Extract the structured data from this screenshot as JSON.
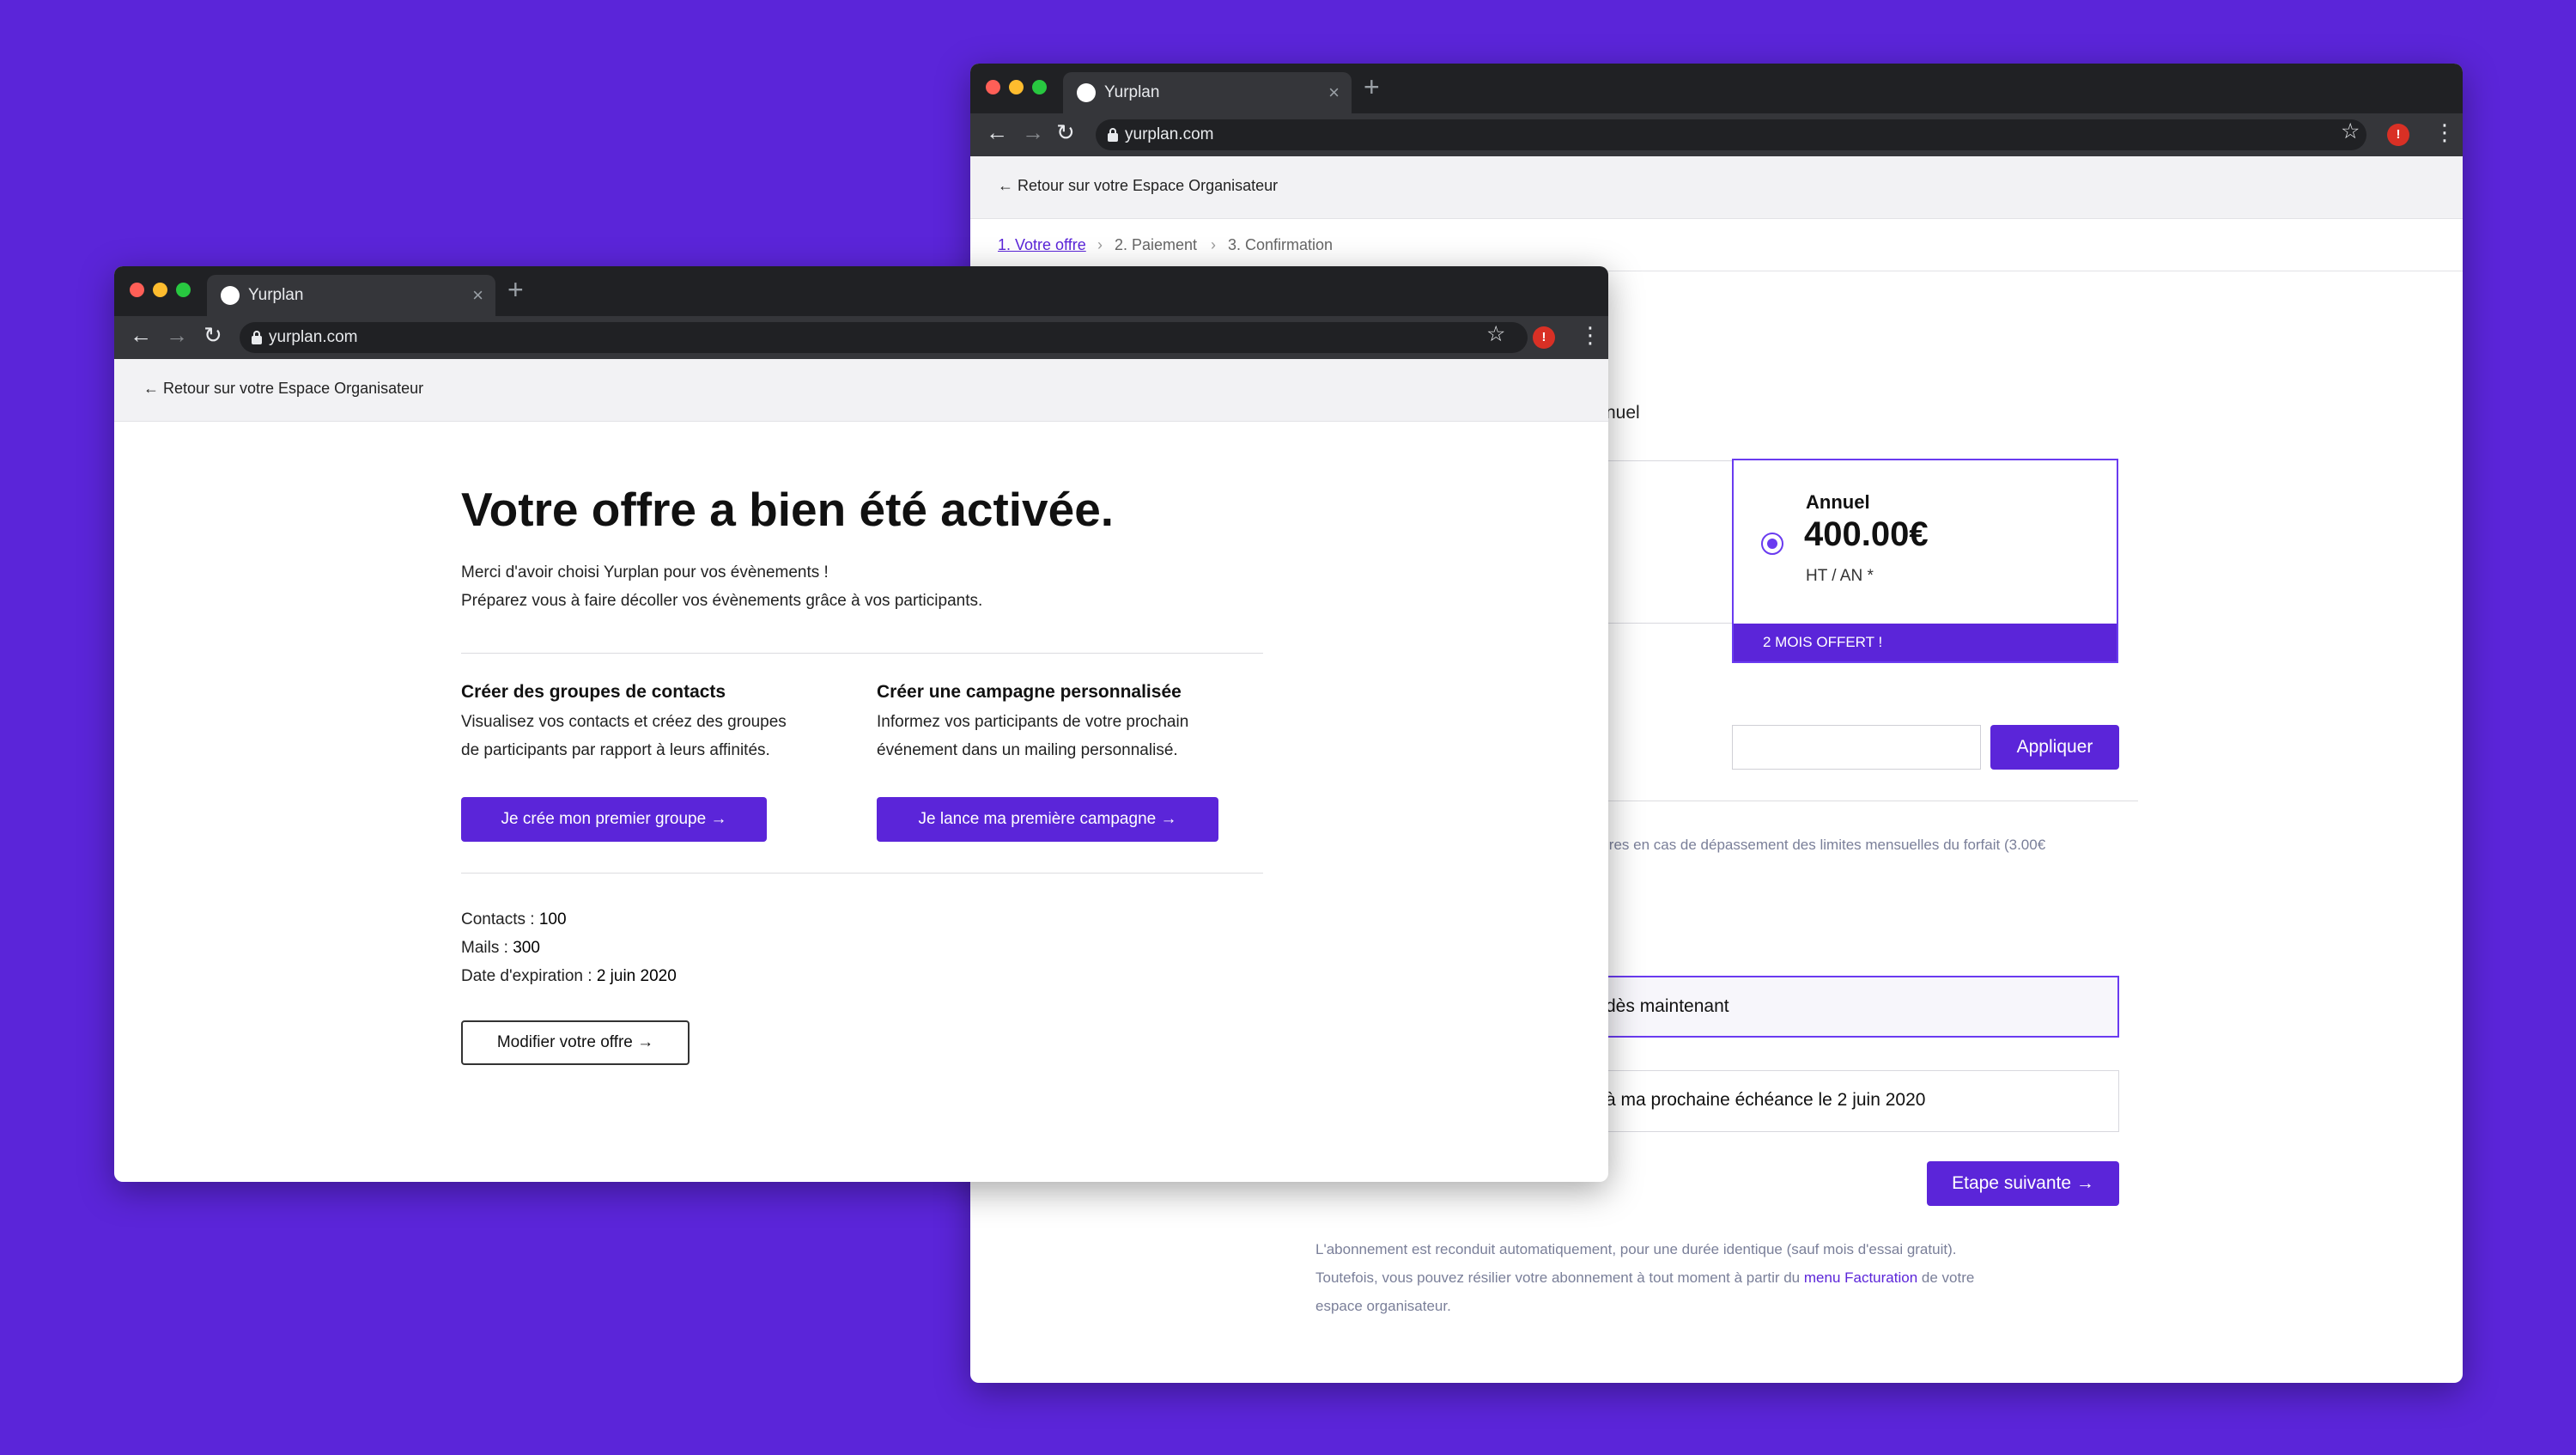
{
  "colors": {
    "background": "#5b25d9",
    "accent": "#5b25d9",
    "accent_light": "#6a3bf0",
    "tab_bar": "#202124",
    "toolbar": "#35363a"
  },
  "browser": {
    "tab_title": "Yurplan",
    "tab_close": "×",
    "new_tab": "+",
    "url": "yurplan.com",
    "icons": {
      "back": "arrow-left-icon",
      "forward": "arrow-right-icon",
      "reload": "reload-icon",
      "lock": "lock-icon",
      "bookmark": "star-icon",
      "extension": "extension-icon",
      "menu": "three-dots-icon"
    },
    "back_glyph": "←",
    "forward_glyph": "→",
    "reload_glyph": "↻",
    "star_glyph": "☆",
    "menu_glyph": "⋮",
    "extension_glyph": "!"
  },
  "back_window": {
    "back_link": "← Retour sur votre Espace Organisateur",
    "breadcrumb": {
      "step1": "1. Votre offre",
      "step2": "2. Paiement",
      "step3": "3. Confirmation",
      "separator": "›"
    },
    "period_label_partial": "nuel",
    "plan": {
      "name": "Annuel",
      "price": "400.00€",
      "unit": "HT / AN *",
      "banner": "2 MOIS OFFERT !",
      "selected": true
    },
    "apply_button": "Appliquer",
    "promo_input_value": "",
    "overage_note_partial": "ires en cas de dépassement des limites mensuelles du forfait (3.00€",
    "option_now": "dès maintenant",
    "option_next": "à ma prochaine échéance le 2 juin 2020",
    "next_button": "Etape suivante →",
    "footnote_line1": "L'abonnement est reconduit automatiquement, pour une durée identique (sauf mois d'essai gratuit).",
    "footnote_line2_pre": "Toutefois, vous pouvez résilier votre abonnement à tout moment à partir du ",
    "footnote_link": "menu Facturation",
    "footnote_line2_post": " de votre",
    "footnote_line3": "espace organisateur."
  },
  "front_window": {
    "back_link": "← Retour sur votre Espace Organisateur",
    "heading": "Votre offre a bien été activée.",
    "intro_line1": "Merci d'avoir choisi Yurplan pour vos évènements !",
    "intro_line2": "Préparez vous à faire décoller vos évènements grâce à vos participants.",
    "groups": {
      "title": "Créer des groupes de contacts",
      "desc_line1": "Visualisez vos contacts et créez des groupes",
      "desc_line2": "de participants par rapport à leurs affinités.",
      "button": "Je crée mon premier groupe →"
    },
    "campaign": {
      "title": "Créer une campagne personnalisée",
      "desc_line1": "Informez vos participants de votre prochain",
      "desc_line2": "événement dans un mailing personnalisé.",
      "button": "Je lance ma première campagne →"
    },
    "stats": {
      "contacts_label": "Contacts : ",
      "contacts_value": "100",
      "mails_label": "Mails : ",
      "mails_value": "300",
      "expiry_label": "Date d'expiration : ",
      "expiry_value": "2 juin 2020"
    },
    "modify_button": "Modifier votre offre →"
  }
}
